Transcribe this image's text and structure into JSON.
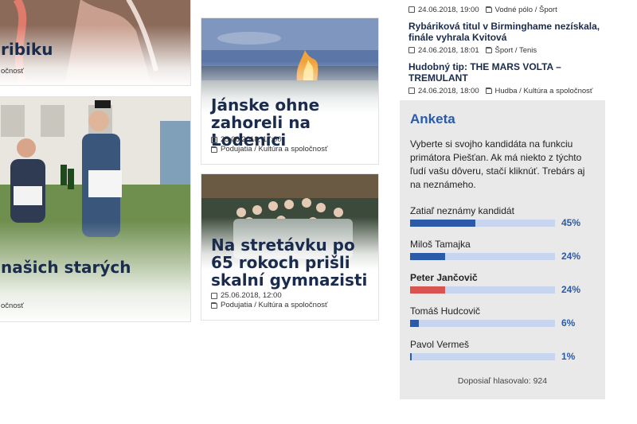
{
  "articles": [
    {
      "title": "ribiku",
      "meta_tags": "očnosť"
    },
    {
      "title": "našich starých",
      "meta_tags": "očnosť"
    },
    {
      "title": "Jánske ohne zahoreli na Lodenici",
      "date": "25.06.2018, 17:00",
      "tags": "Podujatia / Kultúra a spoločnosť"
    },
    {
      "title": "Na stretávku po 65 rokoch prišli skalní gymnazisti",
      "date": "25.06.2018, 12:00",
      "tags": "Podujatia / Kultúra a spoločnosť"
    }
  ],
  "news_list": [
    {
      "date": "24.06.2018, 19:00",
      "tags": "Vodné pólo / Šport"
    },
    {
      "title": "Rybáriková titul v Birminghame nezískala, finále vyhrala Kvitová",
      "date": "24.06.2018, 18:01",
      "tags": "Šport / Tenis"
    },
    {
      "title": "Hudobný tip: THE MARS VOLTA – TREMULANT",
      "date": "24.06.2018, 18:00",
      "tags": "Hudba / Kultúra a spoločnosť"
    }
  ],
  "poll": {
    "heading": "Anketa",
    "question": "Vyberte si svojho kandidáta na funkciu primátora Piešťan. Ak má niekto z týchto ľudí vašu dôveru, stačí kliknúť. Trebárs aj na neznámeho.",
    "options": [
      {
        "name": "Zatiaľ neznámy kandidát",
        "percent": "45%",
        "value": 45,
        "selected": false
      },
      {
        "name": "Miloš Tamajka",
        "percent": "24%",
        "value": 24,
        "selected": false
      },
      {
        "name": "Peter Jančovič",
        "percent": "24%",
        "value": 24,
        "selected": true
      },
      {
        "name": "Tomáš Hudcovič",
        "percent": "6%",
        "value": 6,
        "selected": false
      },
      {
        "name": "Pavol Vermeš",
        "percent": "1%",
        "value": 1,
        "selected": false
      }
    ],
    "total": "Doposiaľ hlasovalo: 924"
  },
  "colors": {
    "accent": "#2b5aa8",
    "headline": "#1a2b4c",
    "selected_bar": "#d9534f",
    "poll_bg": "#e9e9e9"
  },
  "icons": {
    "date": "calendar-icon",
    "category": "folder-icon"
  }
}
